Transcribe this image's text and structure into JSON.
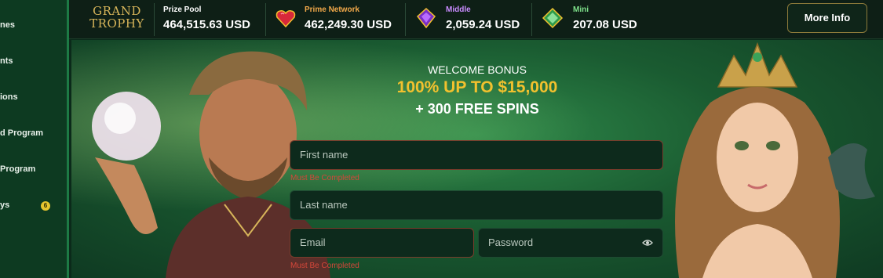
{
  "sidebar": {
    "items": [
      {
        "label": "nes"
      },
      {
        "label": "nts"
      },
      {
        "label": "ions"
      },
      {
        "label": "d Program"
      },
      {
        "label": " Program"
      },
      {
        "label": "ys",
        "badge": "6"
      }
    ]
  },
  "topbar": {
    "logo_line1": "GRAND",
    "logo_line2": "TROPHY",
    "jackpots": [
      {
        "label": "Prize Pool",
        "value": "464,515.63 USD",
        "label_color": "#ffffff"
      },
      {
        "label": "Prime Network",
        "value": "462,249.30 USD",
        "label_color": "#f2a94a"
      },
      {
        "label": "Middle",
        "value": "2,059.24 USD",
        "label_color": "#c98bff"
      },
      {
        "label": "Mini",
        "value": "207.08 USD",
        "label_color": "#7ee08a"
      }
    ],
    "more_info": "More Info"
  },
  "hero": {
    "welcome": "WELCOME BONUS",
    "offer": "100% UP TO $15,000",
    "spins": "+ 300 FREE SPINS"
  },
  "form": {
    "first_name": {
      "placeholder": "First name",
      "error": "Must Be Completed"
    },
    "last_name": {
      "placeholder": "Last name"
    },
    "email": {
      "placeholder": "Email",
      "error": "Must Be Completed"
    },
    "password": {
      "placeholder": "Password"
    }
  },
  "colors": {
    "accent_gold": "#f2c12e",
    "error": "#d5473a",
    "sidebar_border": "#1d7a45"
  }
}
